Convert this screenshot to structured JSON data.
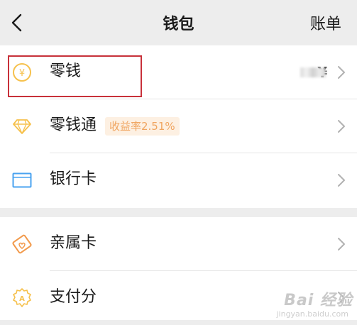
{
  "nav": {
    "title": "钱包",
    "bill_label": "账单"
  },
  "items": [
    {
      "label": "零钱",
      "amount_prefix": "¥",
      "icon": "yen-coin-icon"
    },
    {
      "label": "零钱通",
      "badge": "收益率2.51%",
      "icon": "diamond-icon"
    },
    {
      "label": "银行卡",
      "icon": "bank-card-icon"
    },
    {
      "label": "亲属卡",
      "icon": "family-card-icon"
    },
    {
      "label": "支付分",
      "icon": "pay-score-icon"
    }
  ],
  "watermark": {
    "text": "Bai 经验",
    "sub": "jingyan.baidu.com"
  },
  "colors": {
    "accent": "#f6c14d",
    "highlight_border": "#c8313a",
    "badge_text": "#f0a560",
    "badge_bg": "#fdf0e2",
    "card_blue": "#4aa3f0",
    "family_orange": "#f2994a"
  }
}
